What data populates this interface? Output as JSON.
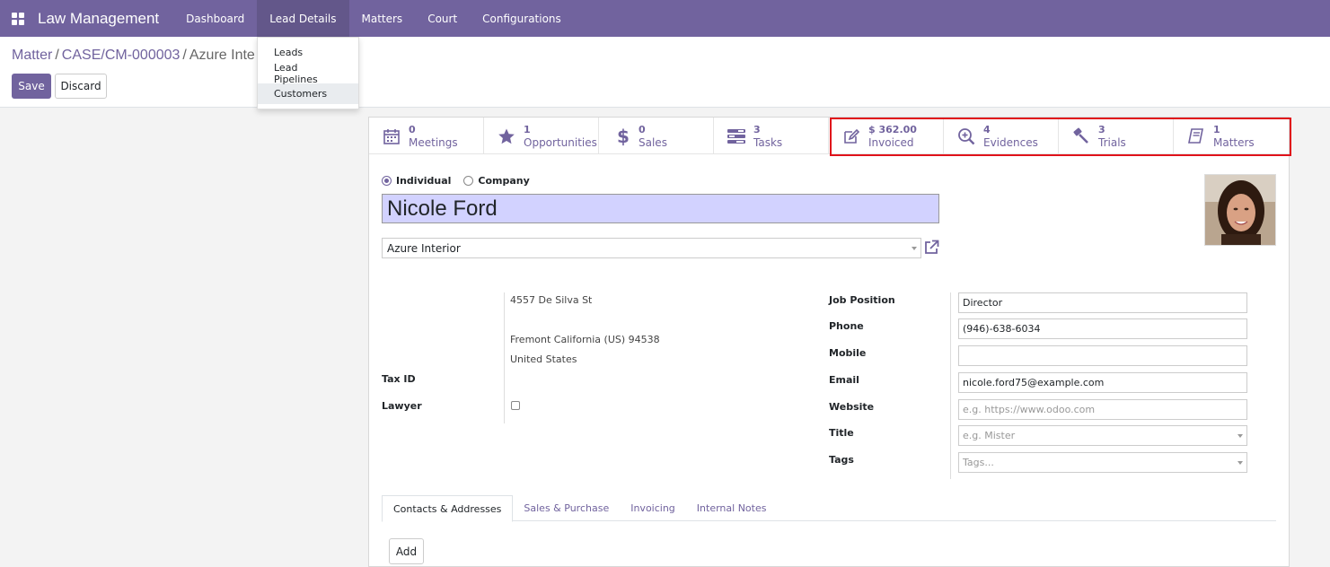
{
  "navbar": {
    "brand": "Law Management",
    "items": [
      {
        "label": "Dashboard"
      },
      {
        "label": "Lead Details"
      },
      {
        "label": "Matters"
      },
      {
        "label": "Court"
      },
      {
        "label": "Configurations"
      }
    ]
  },
  "dropdown": {
    "items": [
      {
        "label": "Leads"
      },
      {
        "label": "Lead Pipelines"
      },
      {
        "label": "Customers"
      }
    ]
  },
  "breadcrumb": {
    "root": "Matter",
    "case": "CASE/CM-000003",
    "current": "Azure Inte"
  },
  "actions": {
    "save": "Save",
    "discard": "Discard"
  },
  "stat_buttons": [
    {
      "value": "0",
      "label": "Meetings",
      "icon": "calendar-icon"
    },
    {
      "value": "1",
      "label": "Opportunities",
      "icon": "star-icon"
    },
    {
      "value": "0",
      "label": "Sales",
      "icon": "dollar-icon"
    },
    {
      "value": "3",
      "label": "Tasks",
      "icon": "tasks-icon"
    },
    {
      "value": "$ 362.00",
      "label": "Invoiced",
      "icon": "edit-icon"
    },
    {
      "value": "4",
      "label": "Evidences",
      "icon": "zoom-icon"
    },
    {
      "value": "3",
      "label": "Trials",
      "icon": "gavel-icon"
    },
    {
      "value": "1",
      "label": "Matters",
      "icon": "book-icon"
    }
  ],
  "form": {
    "type_individual": "Individual",
    "type_company": "Company",
    "name": "Nicole Ford",
    "company": "Azure Interior",
    "address": {
      "street": "4557 De Silva St",
      "city_line": "Fremont  California (US)  94538",
      "country": "United States"
    },
    "tax_id_label": "Tax ID",
    "lawyer_label": "Lawyer",
    "job_position_label": "Job Position",
    "job_position": "Director",
    "phone_label": "Phone",
    "phone": "(946)-638-6034",
    "mobile_label": "Mobile",
    "mobile": "",
    "email_label": "Email",
    "email": "nicole.ford75@example.com",
    "website_label": "Website",
    "website_placeholder": "e.g. https://www.odoo.com",
    "title_label": "Title",
    "title_placeholder": "e.g. Mister",
    "tags_label": "Tags",
    "tags_placeholder": "Tags..."
  },
  "tabs": [
    {
      "label": "Contacts & Addresses"
    },
    {
      "label": "Sales & Purchase"
    },
    {
      "label": "Invoicing"
    },
    {
      "label": "Internal Notes"
    }
  ],
  "add_button": "Add",
  "colors": {
    "brand": "#71639e",
    "name_highlight": "#d2d2ff",
    "annotation_box": "#e0121b"
  }
}
